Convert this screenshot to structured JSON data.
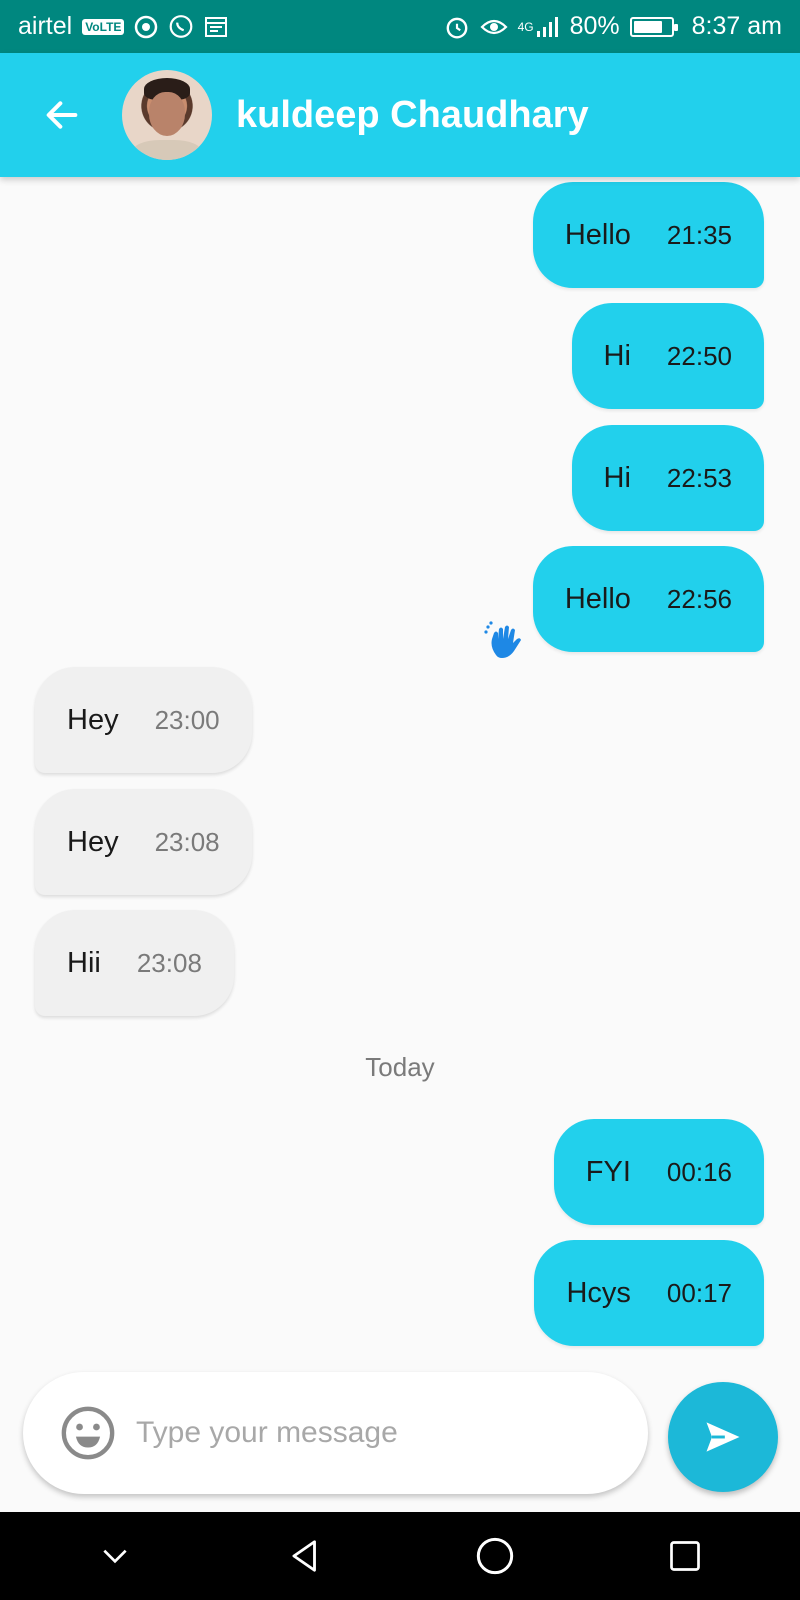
{
  "status_bar": {
    "carrier": "airtel",
    "volte": "VoLTE",
    "network": "4G",
    "battery_percent": "80%",
    "battery_level": 0.8,
    "time": "8:37 am",
    "icons": [
      "chrome-icon",
      "whatsapp-icon",
      "calendar-icon",
      "alarm-icon",
      "eye-icon",
      "signal-icon",
      "battery-icon"
    ]
  },
  "header": {
    "back_icon": "arrow-left-icon",
    "contact_name": "kuldeep Chaudhary",
    "background": "#22d0ec"
  },
  "messages": [
    {
      "direction": "out",
      "text": "Hello",
      "time": "21:35"
    },
    {
      "direction": "out",
      "text": "Hi",
      "time": "22:50"
    },
    {
      "direction": "out",
      "text": "Hi",
      "time": "22:53"
    },
    {
      "direction": "out",
      "text": "Hello",
      "time": "22:56"
    },
    {
      "direction": "in",
      "text": "Hey",
      "time": "23:00"
    },
    {
      "direction": "in",
      "text": "Hey",
      "time": "23:08"
    },
    {
      "direction": "in",
      "text": "Hii",
      "time": "23:08"
    },
    {
      "direction": "out",
      "text": "FYI",
      "time": "00:16"
    },
    {
      "direction": "out",
      "text": "Hcys",
      "time": "00:17"
    }
  ],
  "date_separator": "Today",
  "composer": {
    "placeholder": "Type your message",
    "emoji_icon": "smiley-icon",
    "send_icon": "send-icon"
  },
  "colors": {
    "outgoing_bubble": "#22d0ec",
    "incoming_bubble": "#f0f0f0",
    "status_bar": "#00877f",
    "send_button": "#1cb8d8"
  }
}
